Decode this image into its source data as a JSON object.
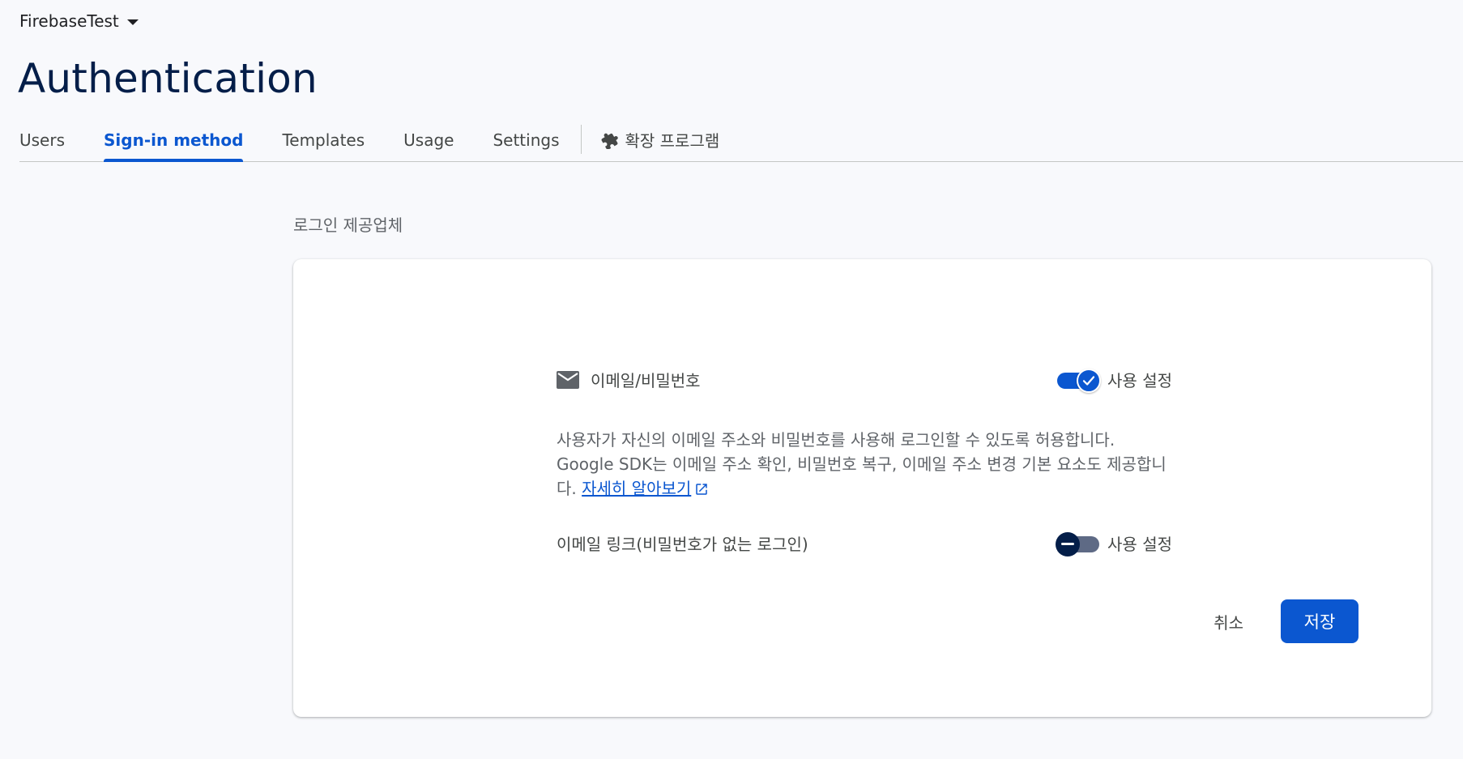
{
  "header": {
    "project_name": "FirebaseTest",
    "page_title": "Authentication"
  },
  "tabs": [
    {
      "label": "Users",
      "active": false
    },
    {
      "label": "Sign-in method",
      "active": true
    },
    {
      "label": "Templates",
      "active": false
    },
    {
      "label": "Usage",
      "active": false
    },
    {
      "label": "Settings",
      "active": false
    }
  ],
  "extensions_tab": {
    "label": "확장 프로그램",
    "icon": "puzzle-icon"
  },
  "section": {
    "label": "로그인 제공업체"
  },
  "provider": {
    "icon": "mail-icon",
    "name": "이메일/비밀번호",
    "toggle_label": "사용 설정",
    "enabled": true,
    "description_prefix": "사용자가 자신의 이메일 주소와 비밀번호를 사용해 로그인할 수 있도록 허용합니다. Google SDK는 이메일 주소 확인, 비밀번호 복구, 이메일 주소 변경 기본 요소도 제공합니다. ",
    "learn_more_label": "자세히 알아보기"
  },
  "email_link": {
    "name": "이메일 링크(비밀번호가 없는 로그인)",
    "toggle_label": "사용 설정",
    "enabled": false
  },
  "actions": {
    "cancel_label": "취소",
    "save_label": "저장"
  },
  "colors": {
    "accent": "#0b57d0",
    "title": "#041e49",
    "background": "#f8f9fc"
  }
}
